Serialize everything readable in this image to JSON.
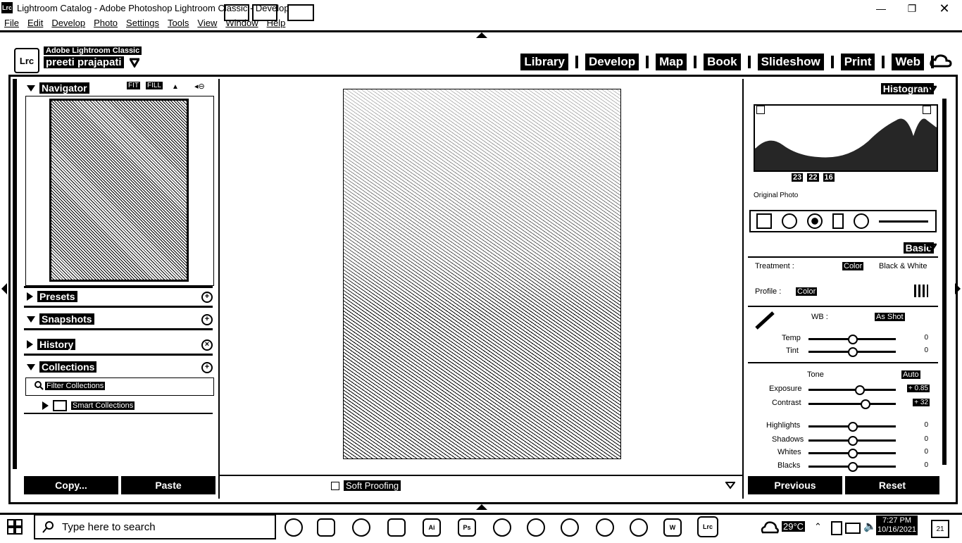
{
  "window": {
    "title": "Lightroom Catalog - Adobe Photoshop Lightroom Classic - Develop",
    "app_icon": "Lrc",
    "controls": [
      "minimize-icon",
      "maximize-icon",
      "close-icon"
    ]
  },
  "menu": [
    "File",
    "Edit",
    "Develop",
    "Photo",
    "Settings",
    "Tools",
    "View",
    "Window",
    "Help"
  ],
  "identity": {
    "badge": "Lrc",
    "brand": "Adobe Lightroom Classic",
    "user": "preeti prajapati"
  },
  "modules": [
    "Library",
    "Develop",
    "Map",
    "Book",
    "Slideshow",
    "Print",
    "Web"
  ],
  "left": {
    "navigator": {
      "title": "Navigator",
      "zoom": [
        "FIT",
        "FILL"
      ]
    },
    "presets": "Presets",
    "snapshots": "Snapshots",
    "history": "History",
    "collections": "Collections",
    "filter_placeholder": "Filter Collections",
    "smart_collections": "Smart Collections",
    "copy": "Copy...",
    "paste": "Paste"
  },
  "center": {
    "soft_proofing": "Soft Proofing"
  },
  "right": {
    "histogram": "Histogram",
    "hist_values": [
      "23",
      "22",
      "16"
    ],
    "original_photo": "Original Photo",
    "basic": "Basic",
    "treatment_label": "Treatment :",
    "treatment_color": "Color",
    "treatment_bw": "Black & White",
    "profile_label": "Profile :",
    "profile_value": "Color",
    "wb_label": "WB :",
    "wb_value": "As Shot",
    "temp": "Temp",
    "tint": "Tint",
    "tone": "Tone",
    "auto": "Auto",
    "exposure": "Exposure",
    "exposure_value": "+ 0.85",
    "contrast": "Contrast",
    "contrast_value": "+ 32",
    "highlights": "Highlights",
    "shadows": "Shadows",
    "whites": "Whites",
    "blacks": "Blacks",
    "zero": "0",
    "previous": "Previous",
    "reset": "Reset"
  },
  "taskbar": {
    "search_placeholder": "Type here to search",
    "temperature": "29°C",
    "time": "7:27 PM",
    "date": "10/16/2021",
    "notifications": "21",
    "apps": [
      "obs-icon",
      "film-icon",
      "edge-icon",
      "file-explorer-icon",
      "illustrator-icon",
      "photoshop-icon",
      "settings-icon",
      "chrome-icon",
      "skype-icon",
      "chat-icon",
      "whatsapp-icon",
      "word-icon",
      "lightroom-icon"
    ]
  }
}
